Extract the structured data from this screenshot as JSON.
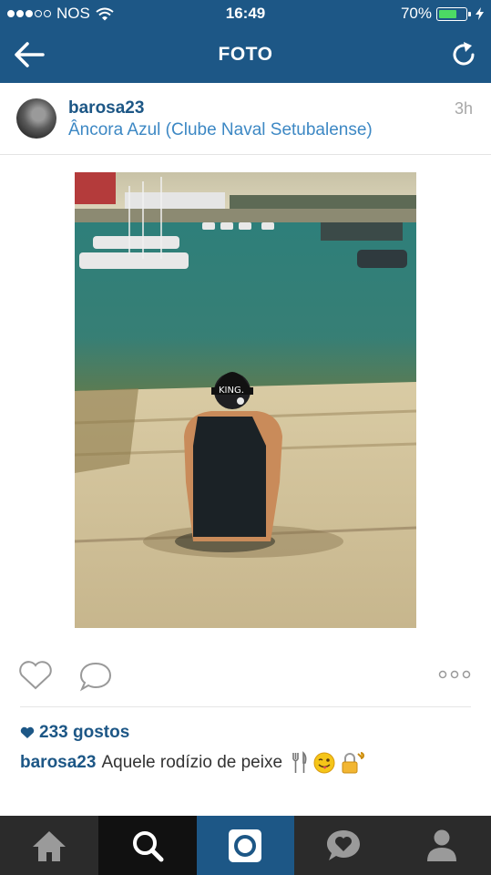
{
  "status_bar": {
    "carrier": "NOS",
    "time": "16:49",
    "battery_percent": "70%",
    "battery_level": 0.7,
    "signal_bars_filled": 3,
    "signal_bars_total": 5
  },
  "nav": {
    "title": "FOTO",
    "back_icon": "arrow-left-icon",
    "refresh_icon": "refresh-icon"
  },
  "post": {
    "username": "barosa23",
    "location": "Âncora Azul (Clube Naval Setubalense)",
    "time_ago": "3h",
    "likes": "233 gostos",
    "caption_user": "barosa23",
    "caption_text": "Aquele rodízio de peixe",
    "caption_emojis": [
      "fork-knife-icon",
      "winking-tongue-face-icon",
      "lock-key-icon"
    ],
    "cap_text": "KING."
  },
  "colors": {
    "brand": "#1d5786",
    "link": "#3d88c4",
    "tabbar": "#2b2b2b"
  },
  "tabs": [
    {
      "name": "home",
      "icon": "home-icon"
    },
    {
      "name": "explore",
      "icon": "search-icon"
    },
    {
      "name": "camera",
      "icon": "camera-icon"
    },
    {
      "name": "activity",
      "icon": "heart-bubble-icon"
    },
    {
      "name": "profile",
      "icon": "profile-icon"
    }
  ]
}
